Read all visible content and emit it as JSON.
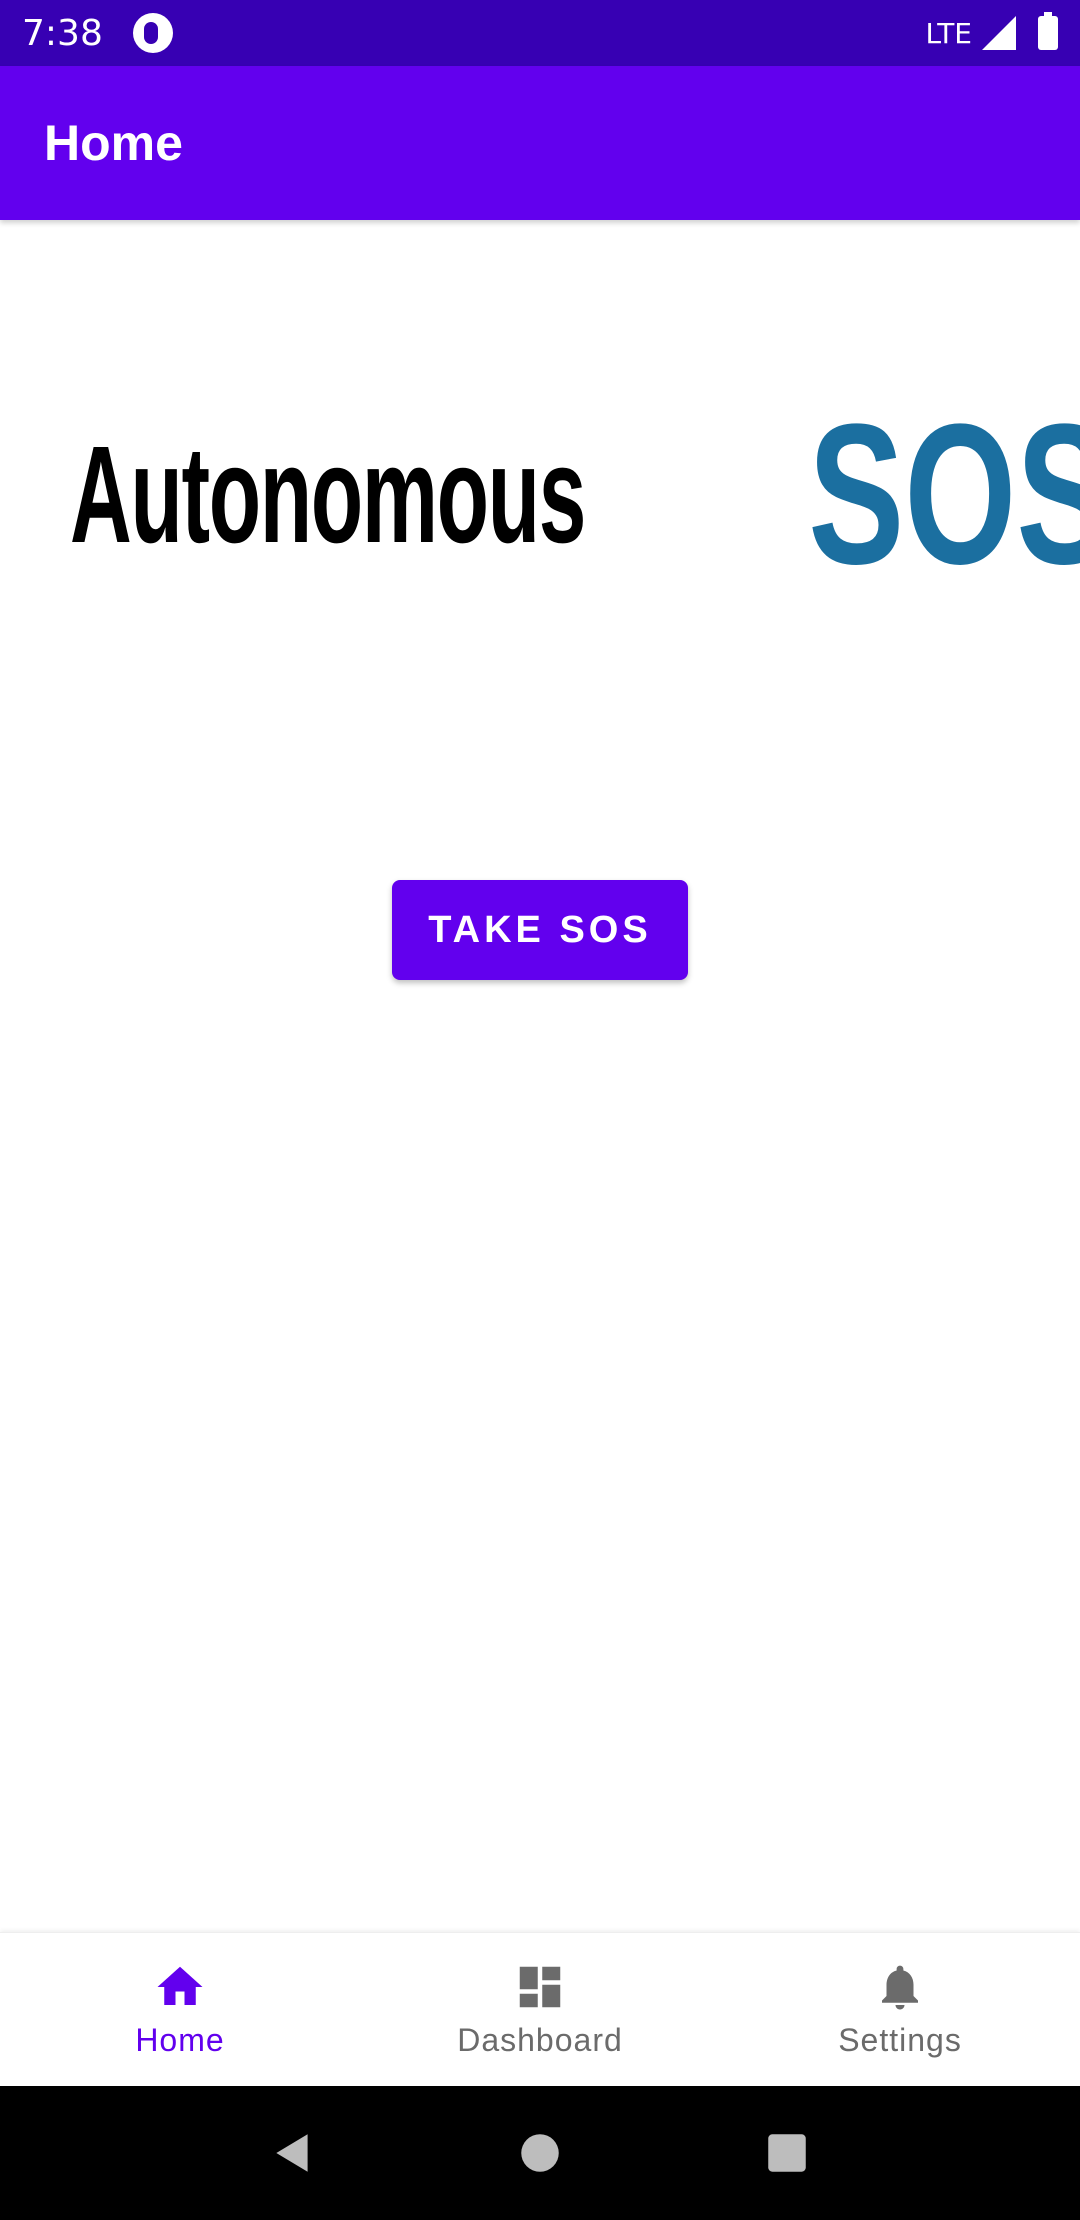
{
  "status_bar": {
    "time": "7:38",
    "network": "LTE"
  },
  "app_bar": {
    "title": "Home"
  },
  "logo": {
    "word1": "Autonomous",
    "word2": "SOS",
    "word2_color": "#1b6fa0"
  },
  "main": {
    "sos_button_label": "TAKE SOS"
  },
  "bottom_nav": {
    "items": [
      {
        "label": "Home",
        "icon": "home-icon",
        "active": true
      },
      {
        "label": "Dashboard",
        "icon": "dashboard-icon",
        "active": false
      },
      {
        "label": "Settings",
        "icon": "bell-icon",
        "active": false
      }
    ]
  },
  "colors": {
    "primary": "#6200ee",
    "primary_dark": "#3700b3",
    "inactive": "#6b6b6b"
  }
}
